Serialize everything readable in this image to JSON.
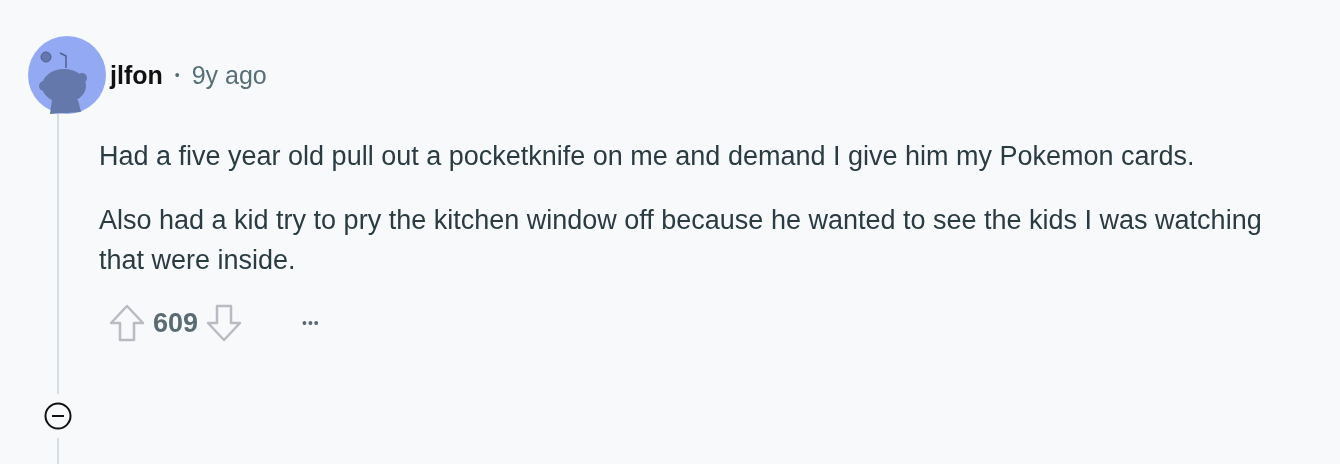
{
  "comment": {
    "author": "jlfon",
    "separator": "•",
    "time": "9y ago",
    "paragraphs": [
      "Had a five year old pull out a pocketknife on me and demand I give him my Pokemon cards.",
      "Also had a kid try to pry the kitchen window off because he wanted to see the kids I was watching that were inside."
    ],
    "score": "609",
    "more": "•••"
  }
}
